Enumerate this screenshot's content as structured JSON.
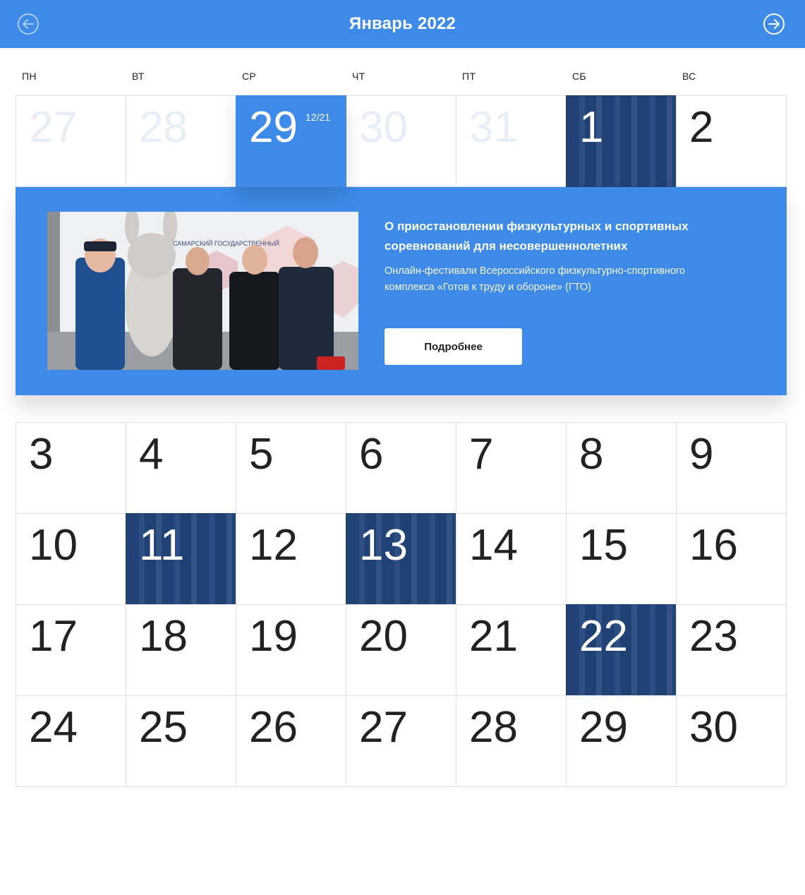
{
  "header": {
    "title": "Январь 2022"
  },
  "weekdays": [
    "ПН",
    "ВТ",
    "СР",
    "ЧТ",
    "ПТ",
    "СБ",
    "ВС"
  ],
  "weeks": [
    [
      "27",
      "28",
      "29",
      "30",
      "31",
      "1",
      "2"
    ],
    [
      "3",
      "4",
      "5",
      "6",
      "7",
      "8",
      "9"
    ],
    [
      "10",
      "11",
      "12",
      "13",
      "14",
      "15",
      "16"
    ],
    [
      "17",
      "18",
      "19",
      "20",
      "21",
      "22",
      "23"
    ],
    [
      "24",
      "25",
      "26",
      "27",
      "28",
      "29",
      "30"
    ]
  ],
  "selected": {
    "mini_date": "12/21"
  },
  "event": {
    "title": "О приостановлении физкультурных и спортивных соревнований для несовершеннолетних",
    "description": "Онлайн-фестивали Всероссийского физкультурно-спортивного комплекса «Готов к труду и обороне» (ГТО)",
    "button": "Подробнее",
    "photo_sign_text": "САМАРСКИЙ ГОСУДАРСТВЕННЫЙ"
  },
  "colors": {
    "accent": "#3d8ae8",
    "event_overlay": "#1f4682",
    "muted_day": "#e8eef8"
  },
  "icons": {
    "prev": "arrow-left-circle-icon",
    "next": "arrow-right-circle-icon"
  }
}
